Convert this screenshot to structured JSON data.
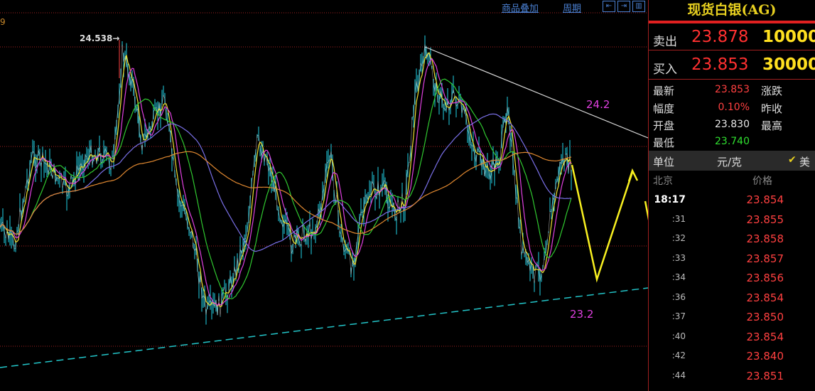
{
  "toolbar": {
    "overlay_label": "商品叠加",
    "period_label": "周期",
    "nav_left": "⇤",
    "nav_right": "⇥"
  },
  "chart": {
    "corner_digit": "9",
    "peak_label": "24.538",
    "resistance_label": "24.2",
    "support_label": "23.2",
    "colors": {
      "price": "#22d4e8",
      "ma_yellow": "#f0e030",
      "ma_magenta": "#e040e0",
      "ma_green": "#30c830",
      "ma_blue": "#7a70e8",
      "ma_orange": "#e08830",
      "forecast": "#f8f020",
      "grid": "#a02020",
      "trend": "#d8d8d8",
      "support": "#22c4c8"
    }
  },
  "panel": {
    "title": "现货白银(AG)",
    "sell_label": "卖出",
    "sell_price": "23.878",
    "sell_vol": "10000",
    "buy_label": "买入",
    "buy_price": "23.853",
    "buy_vol": "30000",
    "stats": [
      {
        "label": "最新",
        "value": "23.853",
        "label2": "涨跌",
        "color": "#ff4040"
      },
      {
        "label": "幅度",
        "value": "0.10%",
        "label2": "昨收",
        "color": "#ff4040"
      },
      {
        "label": "开盘",
        "value": "23.830",
        "label2": "最高",
        "color": "#e8e8e8"
      },
      {
        "label": "最低",
        "value": "23.740",
        "label2": "",
        "color": "#30e030"
      }
    ],
    "unit_label": "单位",
    "unit_value": "元/克",
    "usd_label": "美",
    "ticks_header": {
      "time": "北京",
      "price": "价格"
    },
    "ticks": [
      {
        "time": "18:17",
        "price": "23.854"
      },
      {
        "time": ":31",
        "price": "23.855"
      },
      {
        "time": ":32",
        "price": "23.858"
      },
      {
        "time": ":33",
        "price": "23.857"
      },
      {
        "time": ":34",
        "price": "23.856"
      },
      {
        "time": ":36",
        "price": "23.854"
      },
      {
        "time": ":37",
        "price": "23.850"
      },
      {
        "time": ":40",
        "price": "23.854"
      },
      {
        "time": ":42",
        "price": "23.840"
      },
      {
        "time": ":44",
        "price": "23.851"
      }
    ]
  }
}
